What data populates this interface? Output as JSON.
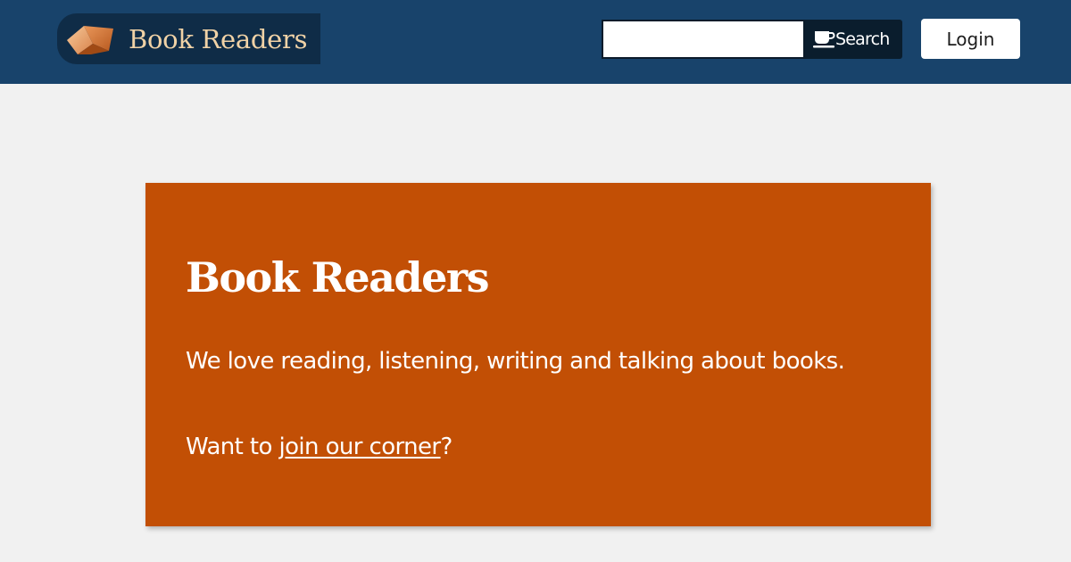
{
  "header": {
    "brand_name": "Book Readers",
    "logo_icon": "open-book-icon",
    "search": {
      "input_value": "",
      "button_icon": "coffee-cup-icon",
      "button_label": "Search"
    },
    "login_label": "Login"
  },
  "hero": {
    "title": "Book Readers",
    "text": "We love reading, listening, writing and talking about books.",
    "cta_prefix": "Want to ",
    "cta_link": "join our corner",
    "cta_suffix": "?"
  },
  "colors": {
    "header_bg": "#18436b",
    "brand_bg": "#0f2c47",
    "brand_text": "#f0d2a6",
    "search_button_bg": "#0a1d2d",
    "page_bg": "#f1f1f1",
    "hero_bg": "#c24f05",
    "hero_text": "#ffffff"
  }
}
